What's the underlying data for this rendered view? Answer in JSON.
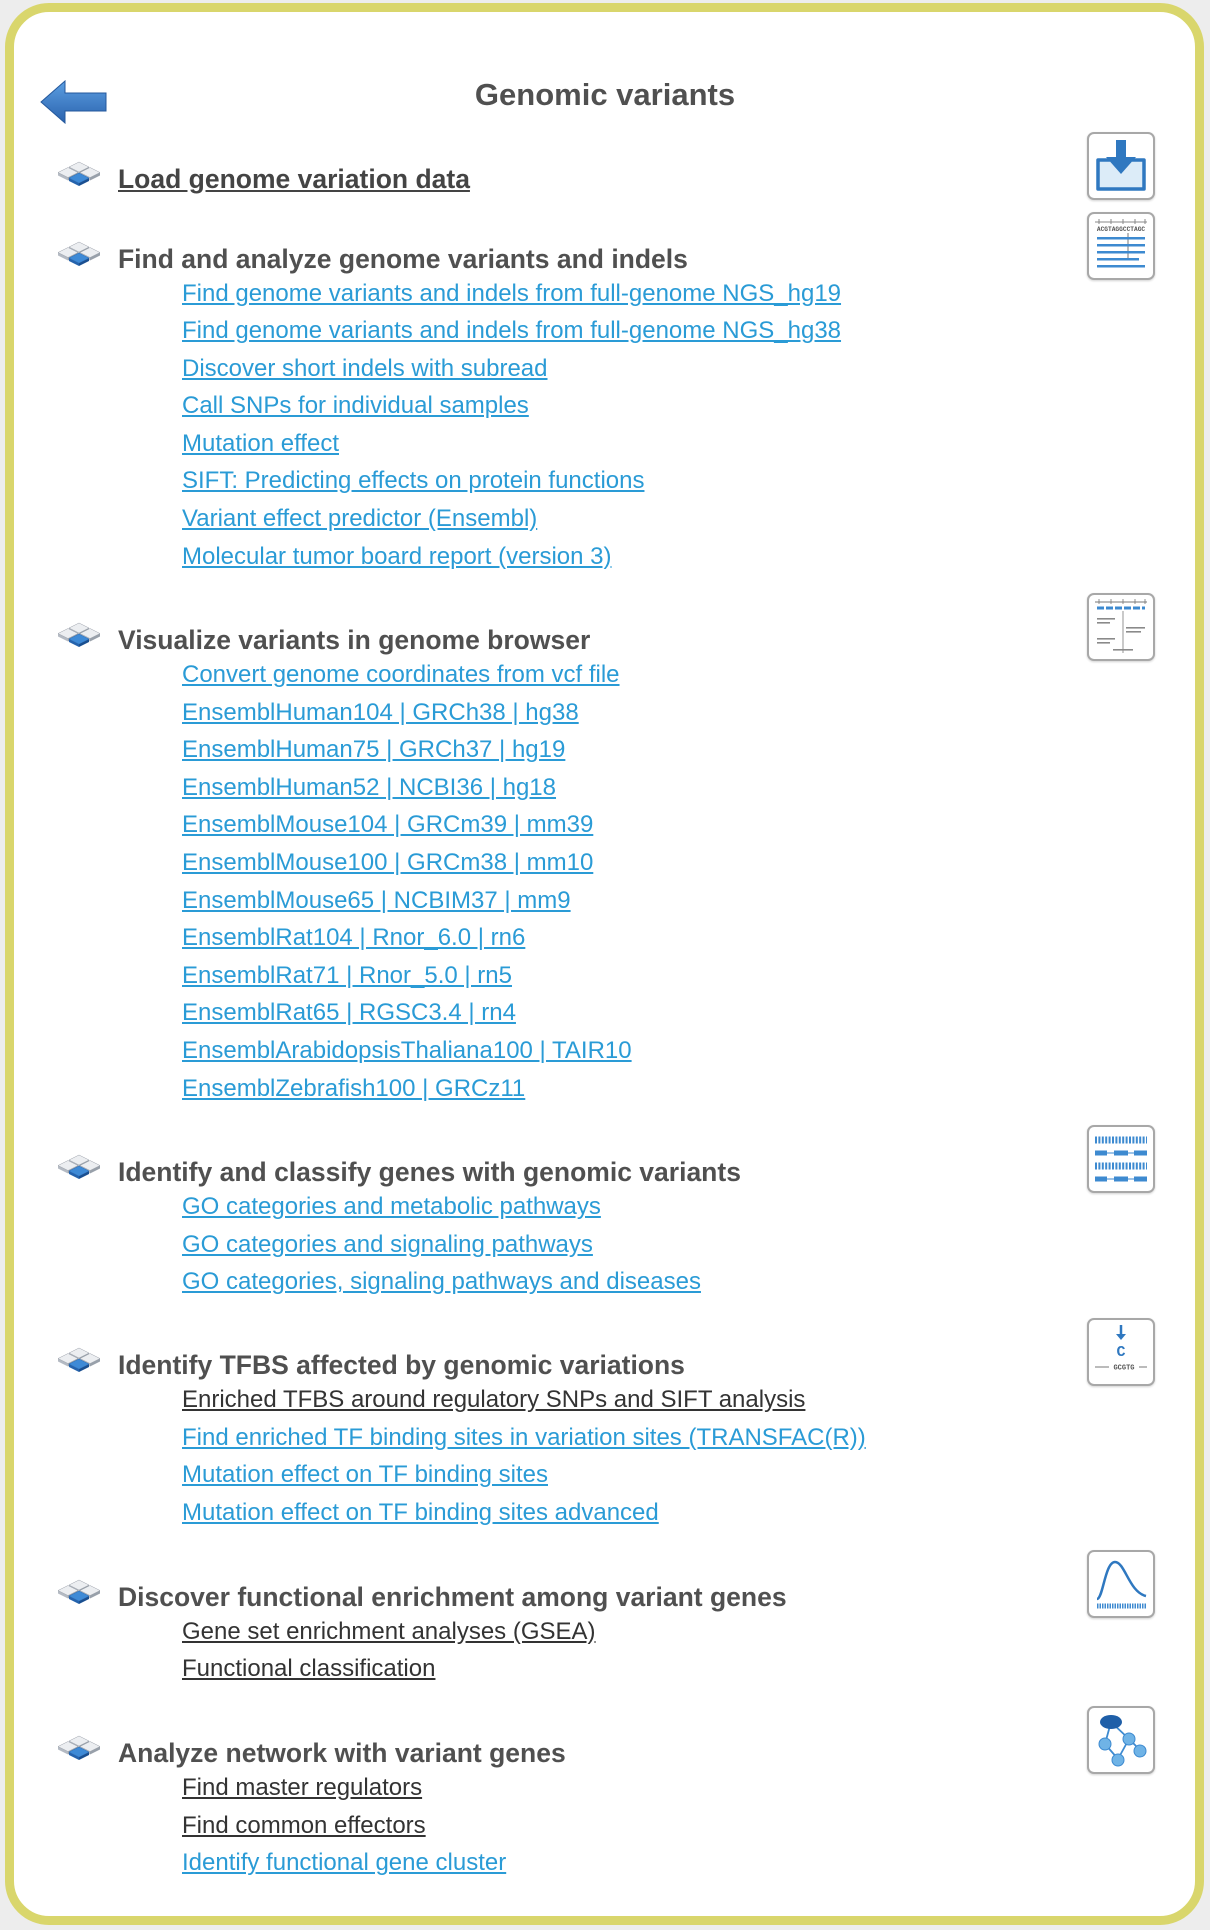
{
  "page": {
    "title": "Genomic variants",
    "back_icon": "back-arrow-icon",
    "bullet_icon": "stacked-tiles-icon"
  },
  "colors": {
    "frame": "#d9d66c",
    "link": "#2a9bd6",
    "link_dark": "#333333",
    "heading": "#505050",
    "icon_blue": "#2f78c0"
  },
  "sections": [
    {
      "heading": "Load genome variation data",
      "icon": "download-icon",
      "links": []
    },
    {
      "heading": "Find and analyze genome variants and indels",
      "icon": "sequence-alignment-icon",
      "icon_text": "ACGTAGGCCTAGC",
      "links": [
        "Find genome variants and indels from full-genome NGS_hg19",
        "Find genome variants and indels from full-genome NGS_hg38",
        "Discover short indels with subread",
        "Call SNPs for individual samples",
        "Mutation effect",
        "SIFT: Predicting effects on protein functions",
        "Variant effect predictor (Ensembl)",
        "Molecular tumor board report (version 3)"
      ]
    },
    {
      "heading": "Visualize variants in genome browser",
      "icon": "genome-browser-icon",
      "links": [
        "Convert genome coordinates from vcf file",
        "EnsemblHuman104 | GRCh38 | hg38",
        "EnsemblHuman75 | GRCh37 | hg19",
        "EnsemblHuman52 | NCBI36 | hg18",
        "EnsemblMouse104 | GRCm39 | mm39",
        "EnsemblMouse100 | GRCm38 | mm10",
        "EnsemblMouse65 | NCBIM37 | mm9",
        "EnsemblRat104 | Rnor_6.0 | rn6",
        "EnsemblRat71 | Rnor_5.0 | rn5",
        "EnsemblRat65 | RGSC3.4 | rn4",
        "EnsemblArabidopsisThaliana100 | TAIR10",
        "EnsemblZebrafish100 | GRCz11"
      ]
    },
    {
      "heading": "Identify and classify genes with genomic variants",
      "icon": "gene-classification-icon",
      "links": [
        "GO categories and metabolic pathways",
        "GO categories and signaling pathways",
        "GO categories, signaling pathways and diseases"
      ]
    },
    {
      "heading": "Identify TFBS affected by genomic variations",
      "icon": "tfbs-icon",
      "icon_text": {
        "base": "C",
        "motif": "GCGTG"
      },
      "links": [
        "Enriched TFBS around regulatory SNPs and SIFT analysis",
        "Find enriched TF binding sites in variation sites (TRANSFAC(R))",
        "Mutation effect on TF binding sites",
        "Mutation effect on TF binding sites advanced"
      ]
    },
    {
      "heading": "Discover functional enrichment among variant genes",
      "icon": "enrichment-curve-icon",
      "links": [
        "Gene set enrichment analyses (GSEA)",
        "Functional classification"
      ]
    },
    {
      "heading": "Analyze network with variant genes",
      "icon": "network-icon",
      "links": [
        "Find master regulators",
        "Find common effectors",
        "Identify functional gene cluster"
      ]
    }
  ]
}
